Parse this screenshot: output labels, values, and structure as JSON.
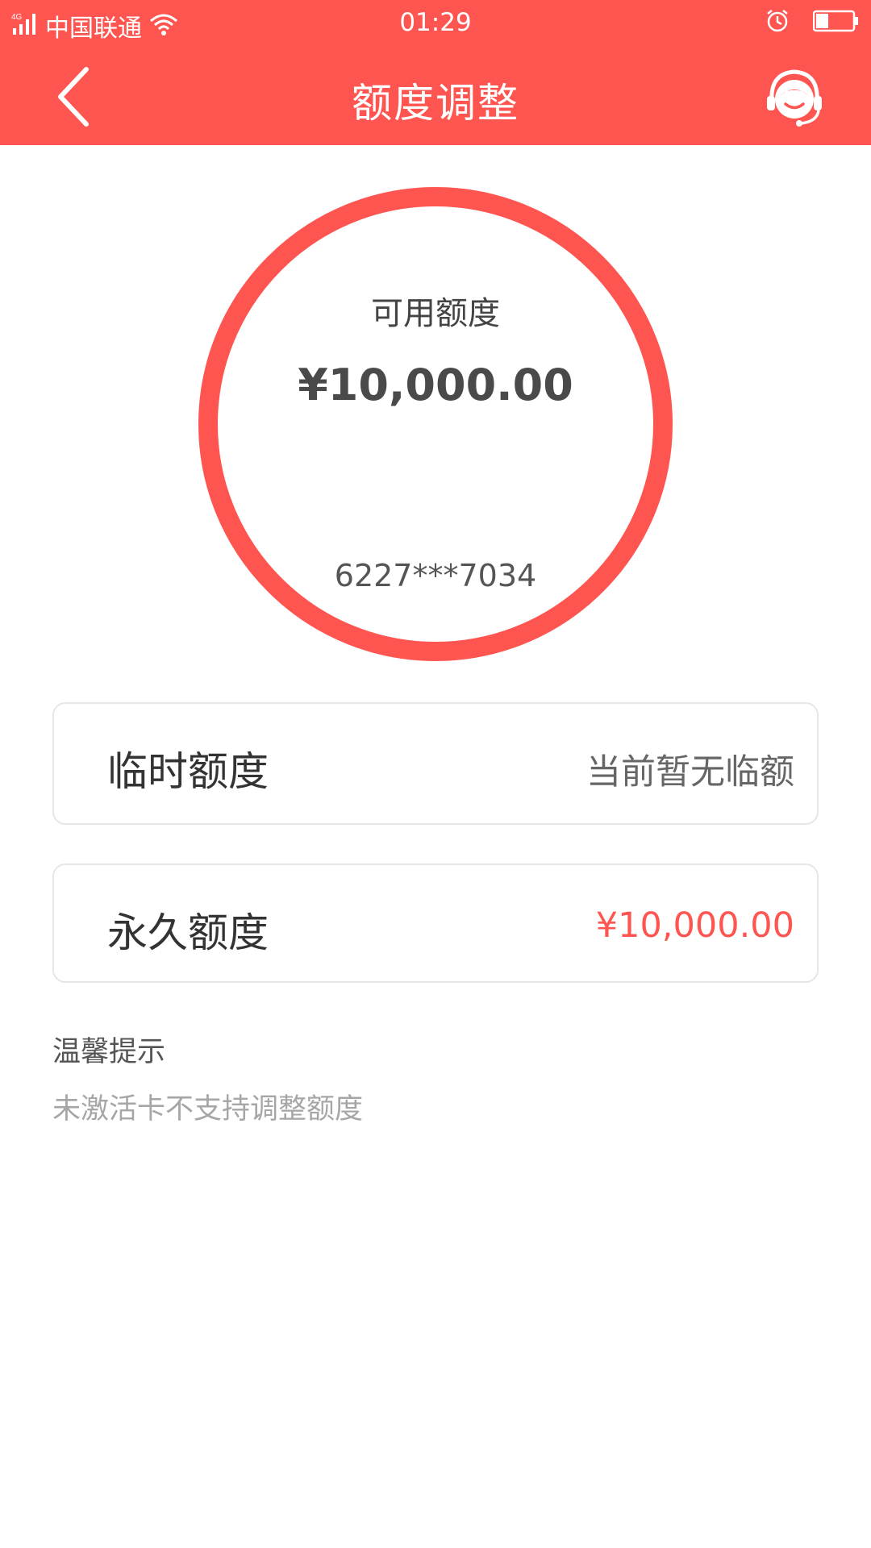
{
  "status_bar": {
    "network": "4G",
    "carrier": "中国联通",
    "time": "01:29",
    "icons": [
      "signal-icon",
      "wifi-icon",
      "alarm-icon",
      "battery-icon"
    ],
    "battery_level": 0.35
  },
  "nav": {
    "title": "额度调整",
    "back_icon": "chevron-left-icon",
    "service_icon": "customer-service-icon"
  },
  "limit": {
    "label": "可用额度",
    "amount": "¥10,000.00",
    "card_number": "6227***7034"
  },
  "rows": {
    "temporary": {
      "label": "临时额度",
      "value": "当前暂无临额"
    },
    "permanent": {
      "label": "永久额度",
      "value": "¥10,000.00"
    }
  },
  "tips": {
    "title": "温馨提示",
    "text": "未激活卡不支持调整额度"
  },
  "colors": {
    "brand": "#ff5550",
    "text_dark": "#333333",
    "text_muted": "#a6a6a6"
  }
}
